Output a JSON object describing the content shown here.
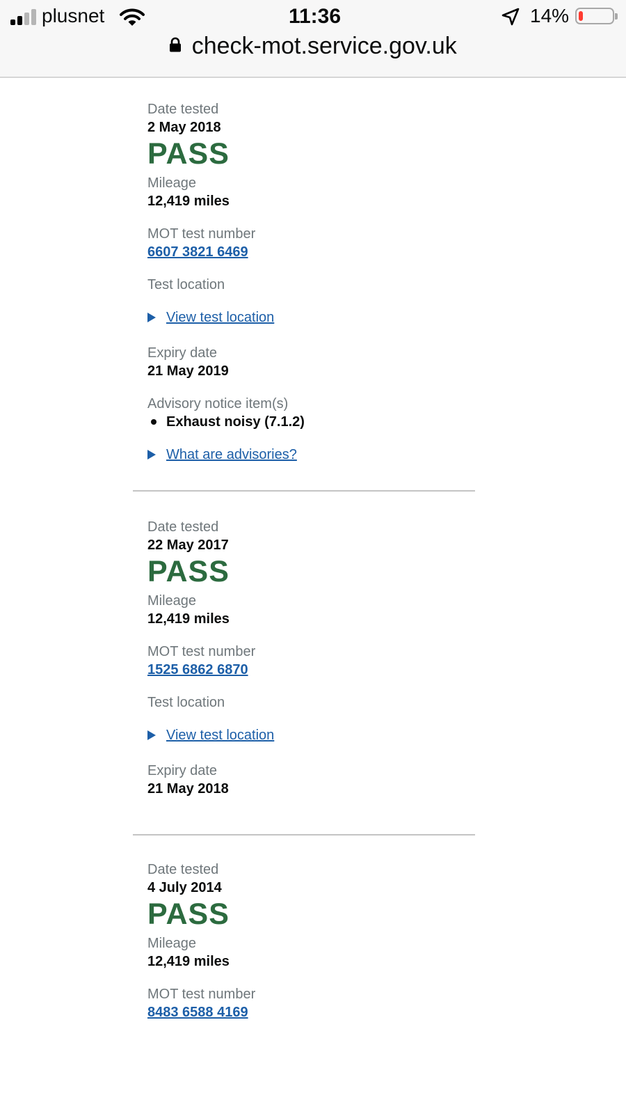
{
  "status_bar": {
    "carrier": "plusnet",
    "time": "11:36",
    "battery_percent": "14%",
    "battery_level": 0.14,
    "battery_color": "#ff3b30"
  },
  "browser": {
    "url": "check-mot.service.gov.uk"
  },
  "labels": {
    "date_tested": "Date tested",
    "mileage": "Mileage",
    "test_number": "MOT test number",
    "test_location": "Test location",
    "view_location": "View test location",
    "expiry_date": "Expiry date",
    "advisory_items": "Advisory notice item(s)",
    "what_are_advisories": "What are advisories?"
  },
  "colors": {
    "pass_green": "#2c6b3f",
    "link_blue": "#1d5fa8",
    "label_grey": "#6f777b"
  },
  "records": [
    {
      "date": "2 May 2018",
      "result": "PASS",
      "mileage": "12,419 miles",
      "test_number": "6607 3821 6469",
      "expiry": "21 May 2019",
      "advisories": [
        "Exhaust noisy (7.1.2)"
      ]
    },
    {
      "date": "22 May 2017",
      "result": "PASS",
      "mileage": "12,419 miles",
      "test_number": "1525 6862 6870",
      "expiry": "21 May 2018"
    },
    {
      "date": "4 July 2014",
      "result": "PASS",
      "mileage": "12,419 miles",
      "test_number": "8483 6588 4169"
    }
  ]
}
